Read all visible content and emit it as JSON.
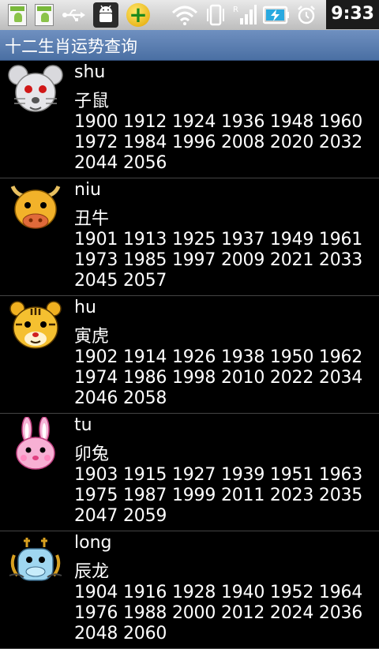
{
  "status_bar": {
    "icons": [
      "notification-icon",
      "notification-icon",
      "usb-icon",
      "android-debug-icon",
      "plus-app-icon",
      "wifi-icon",
      "vibrate-icon",
      "signal-icon",
      "battery-charging-icon",
      "alarm-icon"
    ],
    "time": "9:33"
  },
  "app": {
    "title": "十二生肖运势查询"
  },
  "zodiac": [
    {
      "pinyin": "shu",
      "name": "子鼠",
      "years": "1900 1912 1924 1936 1948 1960 1972 1984 1996 2008 2020 2032 2044 2056",
      "icon": "rat-icon"
    },
    {
      "pinyin": "niu",
      "name": "丑牛",
      "years": "1901 1913 1925 1937 1949 1961 1973 1985 1997 2009 2021 2033 2045 2057",
      "icon": "ox-icon"
    },
    {
      "pinyin": "hu",
      "name": "寅虎",
      "years": "1902 1914 1926 1938 1950 1962 1974 1986 1998 2010 2022 2034 2046 2058",
      "icon": "tiger-icon"
    },
    {
      "pinyin": "tu",
      "name": "卯兔",
      "years": "1903 1915 1927 1939 1951 1963 1975 1987 1999 2011 2023 2035 2047 2059",
      "icon": "rabbit-icon"
    },
    {
      "pinyin": "long",
      "name": "辰龙",
      "years": "1904 1916 1928 1940 1952 1964 1976 1988 2000 2012 2024 2036 2048 2060",
      "icon": "dragon-icon"
    }
  ]
}
